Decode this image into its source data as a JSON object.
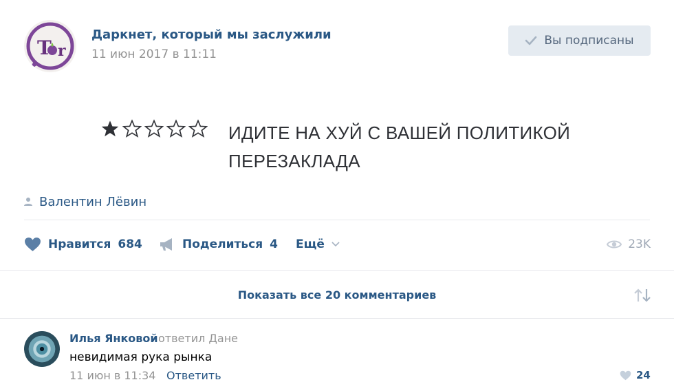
{
  "post": {
    "group_name": "Даркнет, который мы заслужили",
    "date": "11 июн 2017 в 11:11",
    "subscribe_button": "Вы подписаны",
    "avatar_logo_text": "Tor",
    "image": {
      "rating": {
        "filled": 1,
        "total": 5
      },
      "text": "ИДИТЕ НА ХУЙ С ВАШЕЙ ПОЛИТИКОЙ ПЕРЕЗАКЛАДА"
    },
    "author": "Валентин Лёвин"
  },
  "actions": {
    "like_label": "Нравится",
    "like_count": "684",
    "share_label": "Поделиться",
    "share_count": "4",
    "more_label": "Ещё",
    "views": "23K"
  },
  "comments": {
    "show_all": "Показать все 20 комментариев",
    "items": [
      {
        "author": "Илья Янковой",
        "reply_to": "ответил Дане",
        "text": "невидимая рука рынка",
        "date": "11 июн в 11:34",
        "reply_label": "Ответить",
        "likes": "24"
      }
    ]
  },
  "colors": {
    "link": "#2a5885",
    "muted": "#939393",
    "button_bg": "#e5ebf1",
    "icon_gray": "#a0a9b6",
    "tor_purple": "#7d4698"
  },
  "icons": [
    "check-icon",
    "person-icon",
    "heart-icon",
    "megaphone-icon",
    "chevron-down-icon",
    "eye-icon",
    "sort-arrows-icon",
    "small-heart-icon"
  ]
}
